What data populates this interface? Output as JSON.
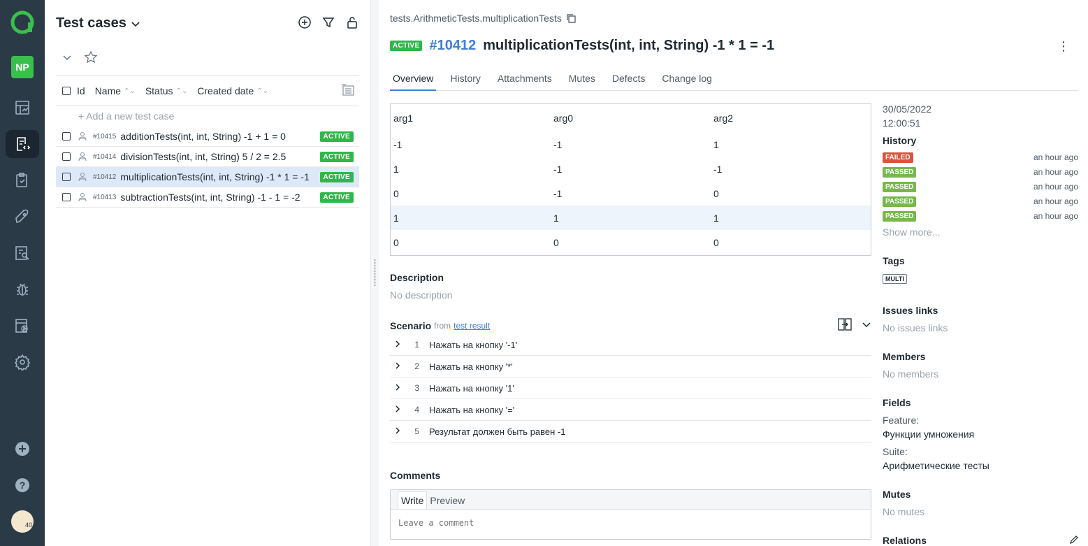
{
  "rail": {
    "project_initials": "NP",
    "avatar_badge": "40"
  },
  "list": {
    "title": "Test cases",
    "columns": {
      "id": "Id",
      "name": "Name",
      "status": "Status",
      "created": "Created date"
    },
    "add_label": "+ Add a new test case",
    "rows": [
      {
        "id": "#10415",
        "name": "additionTests(int, int, String) -1 + 1 = 0",
        "status": "ACTIVE"
      },
      {
        "id": "#10414",
        "name": "divisionTests(int, int, String) 5 / 2 = 2.5",
        "status": "ACTIVE"
      },
      {
        "id": "#10412",
        "name": "multiplicationTests(int, int, String) -1 * 1 = -1",
        "status": "ACTIVE"
      },
      {
        "id": "#10413",
        "name": "subtractionTests(int, int, String) -1 - 1 = -2",
        "status": "ACTIVE"
      }
    ]
  },
  "detail": {
    "path": "tests.ArithmeticTests.multiplicationTests",
    "status": "ACTIVE",
    "id": "#10412",
    "title": "multiplicationTests(int, int, String) -1 * 1 = -1",
    "tabs": [
      "Overview",
      "History",
      "Attachments",
      "Mutes",
      "Defects",
      "Change log"
    ],
    "params": {
      "headers": [
        "arg1",
        "arg0",
        "arg2"
      ],
      "rows": [
        [
          "-1",
          "-1",
          "1"
        ],
        [
          "1",
          "-1",
          "-1"
        ],
        [
          "0",
          "-1",
          "0"
        ],
        [
          "1",
          "1",
          "1"
        ],
        [
          "0",
          "0",
          "0"
        ]
      ]
    },
    "description_label": "Description",
    "description_value": "No description",
    "scenario_label": "Scenario",
    "scenario_from": "from",
    "scenario_link": "test result",
    "steps": [
      {
        "num": "1",
        "text": "Нажать на кнопку '-1'"
      },
      {
        "num": "2",
        "text": "Нажать на кнопку '*'"
      },
      {
        "num": "3",
        "text": "Нажать на кнопку '1'"
      },
      {
        "num": "4",
        "text": "Нажать на кнопку '='"
      },
      {
        "num": "5",
        "text": "Результат должен быть равен -1"
      }
    ],
    "comments_label": "Comments",
    "comment_tab_write": "Write",
    "comment_tab_preview": "Preview",
    "comment_placeholder": "Leave a comment"
  },
  "side": {
    "date": "30/05/2022",
    "time": "12:00:51",
    "history_label": "History",
    "history": [
      {
        "status": "FAILED",
        "when": "an hour ago"
      },
      {
        "status": "PASSED",
        "when": "an hour ago"
      },
      {
        "status": "PASSED",
        "when": "an hour ago"
      },
      {
        "status": "PASSED",
        "when": "an hour ago"
      },
      {
        "status": "PASSED",
        "when": "an hour ago"
      }
    ],
    "show_more": "Show more...",
    "tags_label": "Tags",
    "tag": "MULTI",
    "issues_label": "Issues links",
    "issues_value": "No issues links",
    "members_label": "Members",
    "members_value": "No members",
    "fields_label": "Fields",
    "feature_label": "Feature:",
    "feature_value": "Функции умножения",
    "suite_label": "Suite:",
    "suite_value": "Арифметические тесты",
    "mutes_label": "Mutes",
    "mutes_value": "No mutes",
    "relations_label": "Relations"
  },
  "colors": {
    "rail": "#2b3a47",
    "active_badge": "#2eb84b",
    "failed": "#e0513c",
    "passed": "#76b84c",
    "link": "#3e7fd6",
    "logo": "#3bbf4c"
  }
}
